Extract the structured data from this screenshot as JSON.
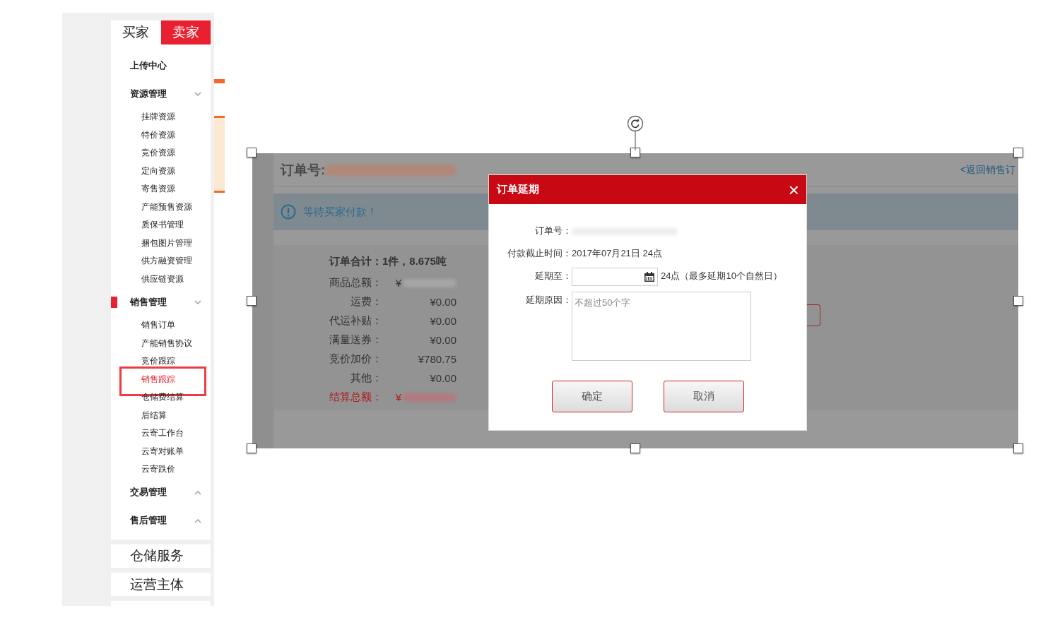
{
  "sidebar_image": {
    "tabs": [
      {
        "label": "买家",
        "selected": false
      },
      {
        "label": "卖家",
        "selected": true
      }
    ],
    "menu": [
      {
        "label": "上传中心"
      },
      {
        "label": "资源管理",
        "expanded": true,
        "children": [
          {
            "label": "挂牌资源",
            "selected": false
          },
          {
            "label": "特价资源",
            "selected": false
          },
          {
            "label": "竞价资源",
            "selected": false
          },
          {
            "label": "定向资源",
            "selected": false
          },
          {
            "label": "寄售资源",
            "selected": false
          },
          {
            "label": "产能预售资源",
            "selected": false
          },
          {
            "label": "质保书管理",
            "selected": false
          },
          {
            "label": "捆包图片管理",
            "selected": false
          },
          {
            "label": "供方融资管理",
            "selected": false
          },
          {
            "label": "供应链资源",
            "selected": false
          }
        ]
      },
      {
        "label": "销售管理",
        "expanded": true,
        "active": true,
        "children": [
          {
            "label": "销售订单",
            "selected": false
          },
          {
            "label": "产能销售协议",
            "selected": false
          },
          {
            "label": "竞价跟踪",
            "selected": false
          },
          {
            "label": "销售跟踪",
            "selected": true
          },
          {
            "label": "仓储费结算",
            "selected": false
          },
          {
            "label": "后结算",
            "selected": false
          },
          {
            "label": "云寄工作台",
            "selected": false
          },
          {
            "label": "云寄对账单",
            "selected": false
          },
          {
            "label": "云寄跌价",
            "selected": false
          }
        ]
      },
      {
        "label": "交易管理",
        "expanded": false
      },
      {
        "label": "售后管理",
        "expanded": false
      }
    ],
    "sections": [
      "仓储服务",
      "运营主体"
    ]
  },
  "order_image": {
    "order_no_label": "订单号:",
    "back_link": "<返回销售订",
    "status": "等待买家付款！",
    "summary_title": "订单合计：1件，8.675吨",
    "summary_rows": [
      {
        "label": "商品总额：",
        "value": "¥",
        "redacted": true,
        "total": false
      },
      {
        "label": "运费：",
        "value": "¥0.00",
        "redacted": false,
        "total": false
      },
      {
        "label": "代运补贴：",
        "value": "¥0.00",
        "redacted": false,
        "total": false
      },
      {
        "label": "满量送券：",
        "value": "¥0.00",
        "redacted": false,
        "total": false
      },
      {
        "label": "竞价加价：",
        "value": "¥780.75",
        "redacted": false,
        "total": false
      },
      {
        "label": "其他：",
        "value": "¥0.00",
        "redacted": false,
        "total": false
      },
      {
        "label": "结算总额：",
        "value": "¥",
        "redacted": true,
        "total": true
      }
    ],
    "dialog": {
      "title": "订单延期",
      "close": "×",
      "fields": [
        {
          "kind": "redacted",
          "label": "订单号："
        },
        {
          "kind": "text",
          "label": "付款截止时间：",
          "value": "2017年07月21日 24点"
        },
        {
          "kind": "date",
          "label": "延期至：",
          "suffix": "24点（最多延期10个自然日）"
        },
        {
          "kind": "textarea",
          "label": "延期原因：",
          "placeholder": "不超过50个字"
        }
      ],
      "buttons": [
        "确定",
        "取消"
      ]
    }
  }
}
